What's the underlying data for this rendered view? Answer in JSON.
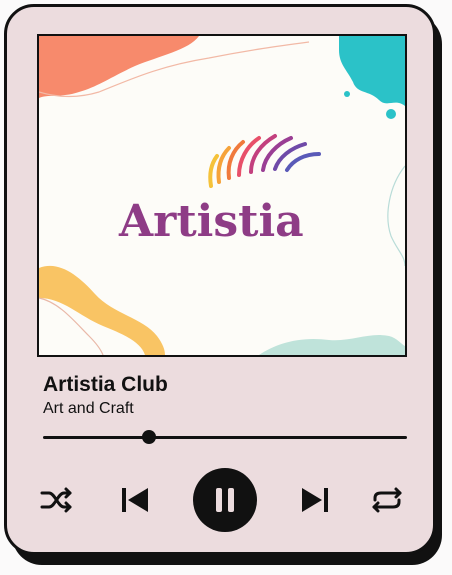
{
  "artwork": {
    "logo_text": "Artistia"
  },
  "track": {
    "title": "Artistia Club",
    "artist": "Art and Craft",
    "progress": 0.29
  },
  "controls": {
    "shuffle_icon": "shuffle-icon",
    "previous_icon": "skip-previous-icon",
    "play_pause_icon": "pause-icon",
    "next_icon": "skip-next-icon",
    "repeat_icon": "repeat-icon"
  },
  "colors": {
    "card_background": "#ecdcde",
    "accent": "#111111",
    "logo": "#8e3c86"
  }
}
